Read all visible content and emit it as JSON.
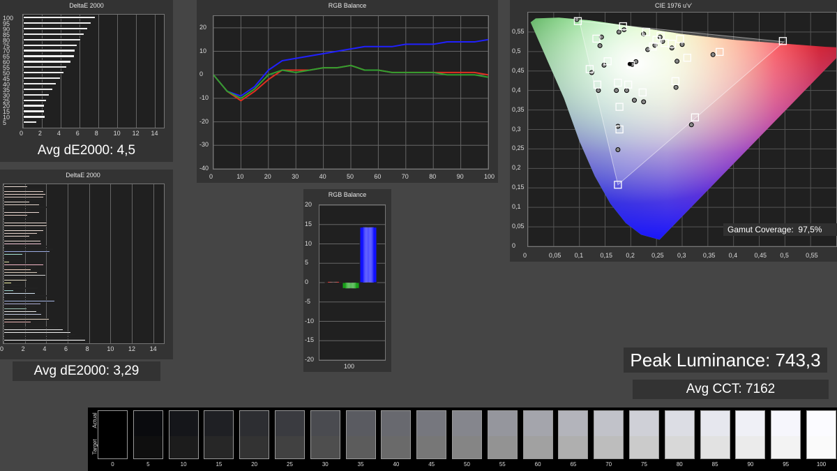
{
  "chart_data": [
    {
      "type": "bar",
      "orientation": "horizontal",
      "title": "DeltaE 2000",
      "categories": [
        100,
        95,
        90,
        85,
        80,
        75,
        70,
        65,
        60,
        55,
        50,
        45,
        40,
        35,
        30,
        25,
        20,
        15,
        10,
        5
      ],
      "values": [
        7.7,
        7.3,
        6.9,
        6.5,
        6.2,
        5.8,
        5.6,
        5.5,
        5.1,
        4.7,
        4.4,
        4.0,
        3.6,
        3.2,
        2.8,
        2.5,
        2.3,
        2.3,
        2.4,
        1.5
      ],
      "xticks": [
        0,
        2,
        4,
        6,
        8,
        10,
        12,
        14
      ],
      "xlim": [
        0,
        15
      ]
    },
    {
      "type": "bar",
      "orientation": "horizontal",
      "title": "DeltaE 2000",
      "values": [
        2.3,
        3.8,
        3.8,
        4.0,
        3.8,
        3.5,
        2.5,
        3.4,
        4.1,
        2.6,
        3.4,
        2.3,
        2.8,
        3.9,
        4.1,
        4.1,
        4.0,
        3.8,
        3.2,
        2.5,
        3.3,
        3.5,
        3.6,
        4.3,
        4.6,
        4.4,
        1.8,
        1.7,
        1.5,
        0.6,
        3.8,
        3.0,
        2.6,
        3.2,
        4.0,
        3.6,
        2.2,
        0.8,
        1.7,
        3.2,
        1.0,
        3.0,
        4.2,
        3.7,
        4.8,
        3.5,
        3.0,
        2.2,
        3.1,
        3.6,
        3.9,
        4.3,
        2.6,
        2.0,
        5.1,
        5.6,
        6.3,
        6.7,
        7.3,
        7.7
      ],
      "colors": [
        "#d8b8a8",
        "#e6b8a6",
        "#c8a292",
        "#d9ae9c",
        "#b59082",
        "#ceb2a2",
        "#e0c2b2",
        "#c2a090",
        "#e8cab8",
        "#b08878",
        "#d2aea0",
        "#c89a88",
        "#e4c6b6",
        "#bc9886",
        "#d4b4a4",
        "#c6a494",
        "#a88676",
        "#e0bcac",
        "#c49e8e",
        "#d8b2a2",
        "#9a7868",
        "#d6b4a4",
        "#e88aa8",
        "#b040c0",
        "#40a0b0",
        "#3050c0",
        "#40c0a0",
        "#c04040",
        "#208040",
        "#c0c040",
        "#e06080",
        "#8060b0",
        "#e0a080",
        "#b09070",
        "#a0a0a0",
        "#7070c0",
        "#c0b080",
        "#e0e040",
        "#d08060",
        "#c04080",
        "#40b0a0",
        "#a0c0e0",
        "#c0a0d0",
        "#707070",
        "#4060c0",
        "#5050a0",
        "#4090b0",
        "#308060",
        "#d0d0d0",
        "#8090c0",
        "#c080a0",
        "#c0a080",
        "#d06060",
        "#b0b0b0",
        "#c8c8c8",
        "#d8d8d8",
        "#e0e0e0",
        "#e8e8e8",
        "#f0f0f0",
        "#ffffff"
      ],
      "xticks": [
        0,
        2,
        4,
        6,
        8,
        10,
        12,
        14
      ],
      "xlim": [
        0,
        15
      ]
    },
    {
      "type": "line",
      "title": "RGB Balance",
      "x": [
        0,
        5,
        10,
        15,
        20,
        25,
        30,
        35,
        40,
        45,
        50,
        55,
        60,
        65,
        70,
        75,
        80,
        85,
        90,
        95,
        100
      ],
      "series": [
        {
          "color": "#2020ff",
          "values": [
            0,
            -7,
            -9,
            -5,
            2,
            6,
            7,
            8,
            9,
            10,
            11,
            12,
            12,
            12,
            13,
            13,
            13,
            14,
            14,
            14,
            15
          ]
        },
        {
          "color": "#e03020",
          "values": [
            0,
            -7,
            -11,
            -7,
            -2,
            2,
            2,
            2,
            3,
            3,
            4,
            2,
            2,
            1,
            1,
            1,
            1,
            1,
            1,
            1,
            0
          ]
        },
        {
          "color": "#30a030",
          "values": [
            0,
            -7,
            -10,
            -6,
            0,
            2,
            1,
            2,
            3,
            3,
            4,
            2,
            2,
            1,
            1,
            1,
            1,
            0,
            0,
            0,
            -1
          ]
        }
      ],
      "xticks": [
        0,
        10,
        20,
        30,
        40,
        50,
        60,
        70,
        80,
        90,
        100
      ],
      "yticks": [
        20,
        10,
        0,
        -10,
        -20,
        -30,
        -40
      ],
      "xlim": [
        0,
        100
      ],
      "ylim": [
        -40,
        25
      ]
    },
    {
      "type": "bar",
      "title": "RGB Balance",
      "categories": [
        "100"
      ],
      "values": [
        0.2,
        -1.5,
        14.3
      ],
      "colors": [
        "#e02020",
        "#18a018",
        "#1010ff"
      ],
      "yticks": [
        20,
        15,
        10,
        5,
        0,
        -5,
        -10,
        -15,
        -20
      ],
      "ylim": [
        -20,
        20
      ]
    },
    {
      "type": "scatter",
      "title": "CIE 1976 u'v'",
      "xticks": [
        "0",
        "0,05",
        "0,1",
        "0,15",
        "0,2",
        "0,25",
        "0,3",
        "0,35",
        "0,4",
        "0,45",
        "0,5",
        "0,55"
      ],
      "yticks": [
        "0,55",
        "0,5",
        "0,45",
        "0,4",
        "0,35",
        "0,3",
        "0,25",
        "0,2",
        "0,15",
        "0,1",
        "0,05",
        "0"
      ],
      "xlim": [
        0,
        0.6
      ],
      "ylim": [
        0,
        0.6
      ],
      "targets": [
        [
          0.097,
          0.578
        ],
        [
          0.185,
          0.565
        ],
        [
          0.133,
          0.533
        ],
        [
          0.23,
          0.55
        ],
        [
          0.258,
          0.54
        ],
        [
          0.266,
          0.522
        ],
        [
          0.243,
          0.513
        ],
        [
          0.28,
          0.52
        ],
        [
          0.296,
          0.532
        ],
        [
          0.25,
          0.53
        ],
        [
          0.31,
          0.484
        ],
        [
          0.373,
          0.499
        ],
        [
          0.496,
          0.527
        ],
        [
          0.155,
          0.475
        ],
        [
          0.12,
          0.455
        ],
        [
          0.2,
          0.465
        ],
        [
          0.135,
          0.415
        ],
        [
          0.175,
          0.42
        ],
        [
          0.195,
          0.415
        ],
        [
          0.287,
          0.424
        ],
        [
          0.223,
          0.395
        ],
        [
          0.178,
          0.358
        ],
        [
          0.178,
          0.3
        ],
        [
          0.325,
          0.331
        ],
        [
          0.175,
          0.158
        ]
      ],
      "measured": [
        [
          0.095,
          0.582
        ],
        [
          0.187,
          0.556
        ],
        [
          0.143,
          0.537
        ],
        [
          0.177,
          0.55
        ],
        [
          0.14,
          0.515
        ],
        [
          0.225,
          0.545
        ],
        [
          0.257,
          0.537
        ],
        [
          0.247,
          0.516
        ],
        [
          0.233,
          0.505
        ],
        [
          0.262,
          0.526
        ],
        [
          0.28,
          0.509
        ],
        [
          0.3,
          0.518
        ],
        [
          0.29,
          0.475
        ],
        [
          0.36,
          0.492
        ],
        [
          0.203,
          0.467
        ],
        [
          0.21,
          0.474
        ],
        [
          0.148,
          0.465
        ],
        [
          0.124,
          0.446
        ],
        [
          0.137,
          0.4
        ],
        [
          0.172,
          0.4
        ],
        [
          0.192,
          0.4
        ],
        [
          0.288,
          0.408
        ],
        [
          0.225,
          0.371
        ],
        [
          0.207,
          0.375
        ],
        [
          0.175,
          0.308
        ],
        [
          0.175,
          0.248
        ],
        [
          0.318,
          0.312
        ]
      ],
      "white_point": [
        0.198,
        0.468
      ],
      "annotation": {
        "label": "Gamut Coverage:",
        "value": "97,5%"
      }
    }
  ],
  "stats": {
    "avg_de_1": "Avg dE2000: 4,5",
    "avg_de_2": "Avg dE2000: 3,29",
    "peak_luminance": "Peak Luminance: 743,3",
    "avg_cct": "Avg CCT: 7162"
  },
  "grayscale": {
    "actual_label": "Actual",
    "target_label": "Target",
    "steps": [
      "0",
      "5",
      "10",
      "15",
      "20",
      "25",
      "30",
      "35",
      "40",
      "45",
      "50",
      "55",
      "60",
      "65",
      "70",
      "75",
      "80",
      "85",
      "90",
      "95",
      "100"
    ],
    "actual": [
      "#000000",
      "#0a0b0e",
      "#15161a",
      "#1f2024",
      "#2d2e32",
      "#3a3b40",
      "#4a4b50",
      "#5a5b61",
      "#68696f",
      "#76777e",
      "#85868d",
      "#95969d",
      "#a4a5ac",
      "#b3b4bb",
      "#c1c2c9",
      "#cfd0d7",
      "#dcdde4",
      "#e6e7ee",
      "#eff0f6",
      "#f6f6fc",
      "#fbfbff"
    ],
    "target": [
      "#000000",
      "#0f0f0f",
      "#1c1c1c",
      "#272727",
      "#333333",
      "#414141",
      "#4e4e4e",
      "#5c5c5c",
      "#6a6a6a",
      "#777777",
      "#858585",
      "#939393",
      "#a1a1a1",
      "#afafaf",
      "#bdbdbd",
      "#cbcbcb",
      "#d8d8d8",
      "#e2e2e2",
      "#ebebeb",
      "#f3f3f3",
      "#fafafa"
    ]
  }
}
